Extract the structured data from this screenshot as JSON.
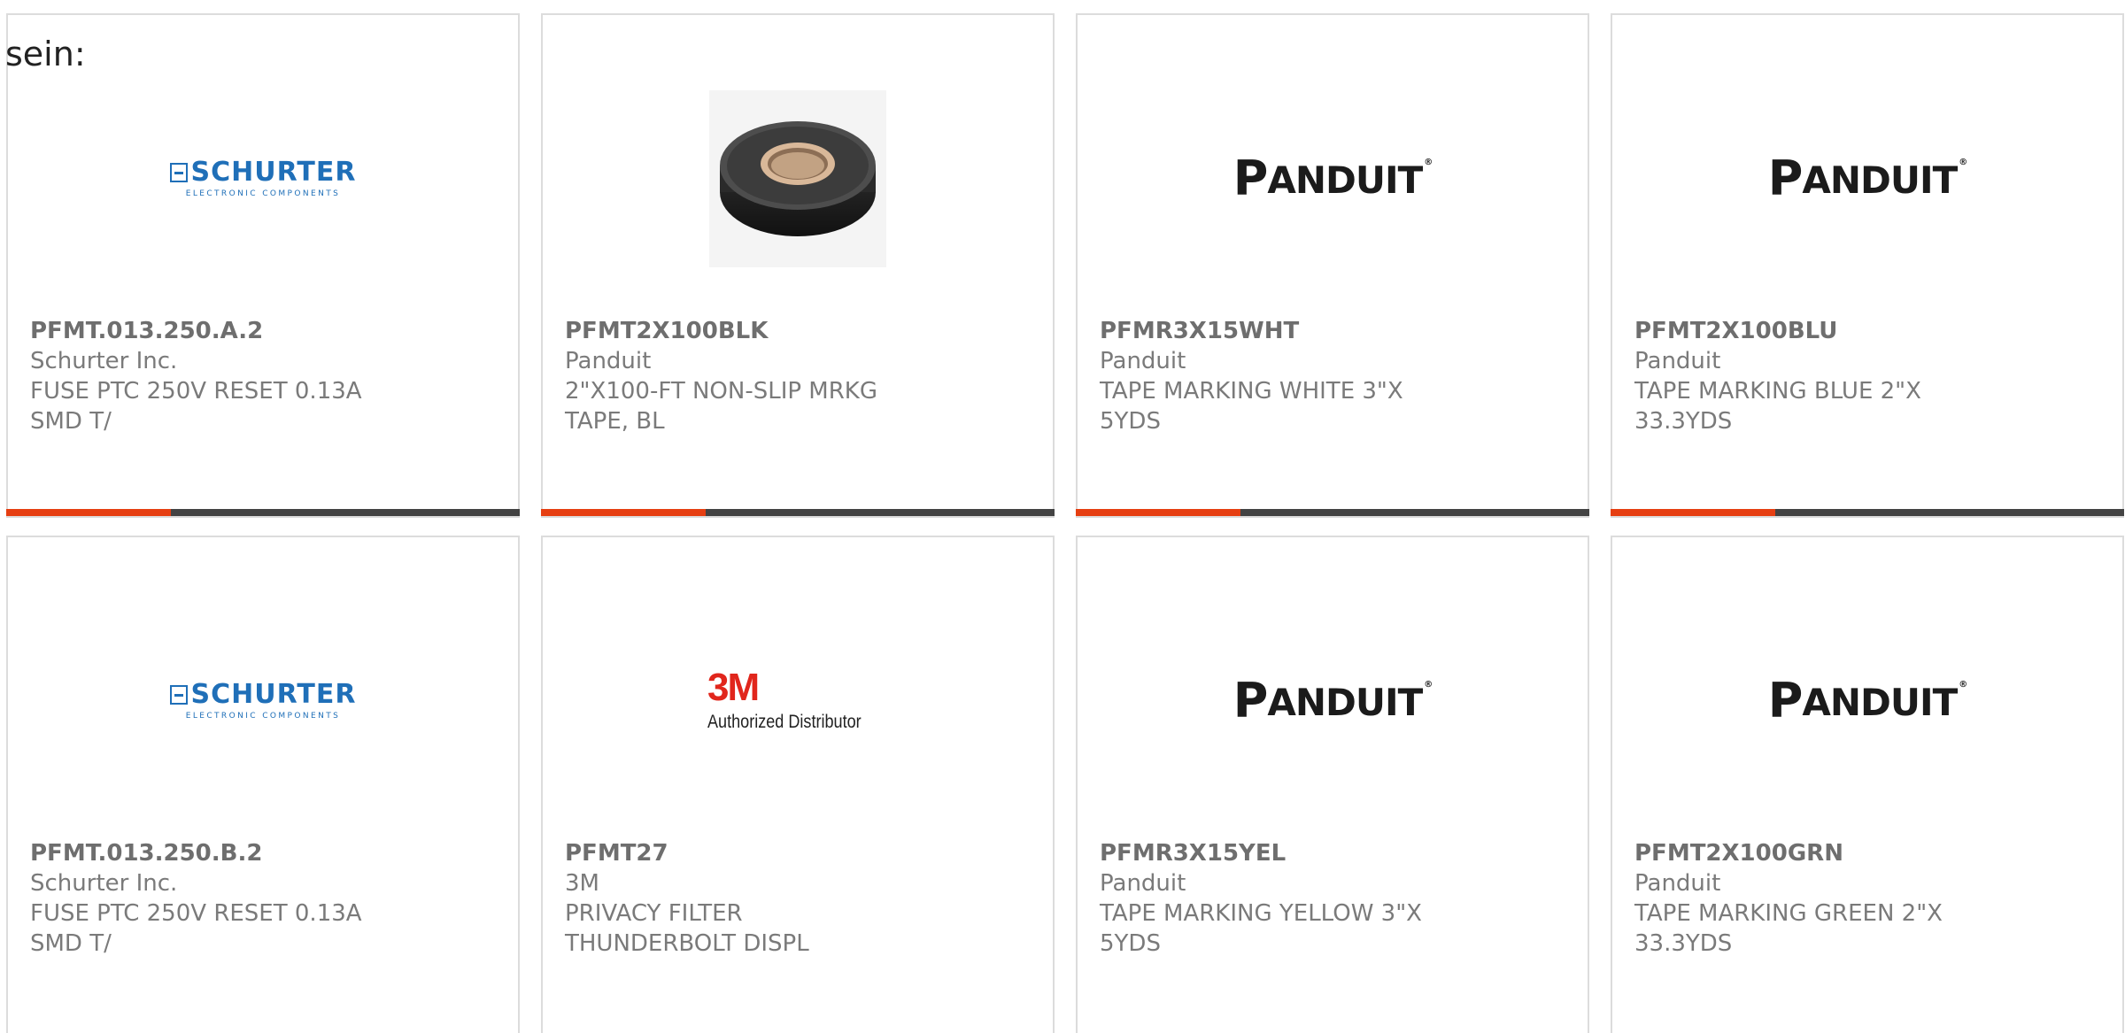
{
  "intro_text": "sein:",
  "logos": {
    "schurter_name": "SCHURTER",
    "schurter_tagline": "ELECTRONIC COMPONENTS",
    "panduit_first": "P",
    "panduit_rest": "ANDUIT",
    "panduit_mark": "®",
    "m3_name": "3M",
    "m3_tagline": "Authorized Distributor"
  },
  "colors": {
    "accent": "#e63f12",
    "bar_track": "#434343",
    "text": "#7a7a7a",
    "schurter_blue": "#1f6fb8",
    "m3_red": "#e1261c"
  },
  "products": [
    {
      "part_number": "PFMT.013.250.A.2",
      "manufacturer": "Schurter Inc.",
      "description": "FUSE PTC 250V RESET 0.13A SMD T/",
      "image": "schurter-logo",
      "progress": 0.32
    },
    {
      "part_number": "PFMT2X100BLK",
      "manufacturer": "Panduit",
      "description": "2\"X100-FT NON-SLIP MRKG TAPE, BL",
      "image": "tape-roll",
      "progress": 0.32
    },
    {
      "part_number": "PFMR3X15WHT",
      "manufacturer": "Panduit",
      "description": "TAPE MARKING WHITE 3\"X 5YDS",
      "image": "panduit-logo",
      "progress": 0.32
    },
    {
      "part_number": "PFMT2X100BLU",
      "manufacturer": "Panduit",
      "description": "TAPE MARKING BLUE 2\"X 33.3YDS",
      "image": "panduit-logo",
      "progress": 0.32
    },
    {
      "part_number": "PFMT.013.250.B.2",
      "manufacturer": "Schurter Inc.",
      "description": "FUSE PTC 250V RESET 0.13A SMD T/",
      "image": "schurter-logo",
      "progress": null
    },
    {
      "part_number": "PFMT27",
      "manufacturer": "3M",
      "description": "PRIVACY FILTER THUNDERBOLT DISPL",
      "image": "3m-logo",
      "progress": null
    },
    {
      "part_number": "PFMR3X15YEL",
      "manufacturer": "Panduit",
      "description": "TAPE MARKING YELLOW 3\"X 5YDS",
      "image": "panduit-logo",
      "progress": null
    },
    {
      "part_number": "PFMT2X100GRN",
      "manufacturer": "Panduit",
      "description": "TAPE MARKING GREEN 2\"X 33.3YDS",
      "image": "panduit-logo",
      "progress": null
    }
  ]
}
